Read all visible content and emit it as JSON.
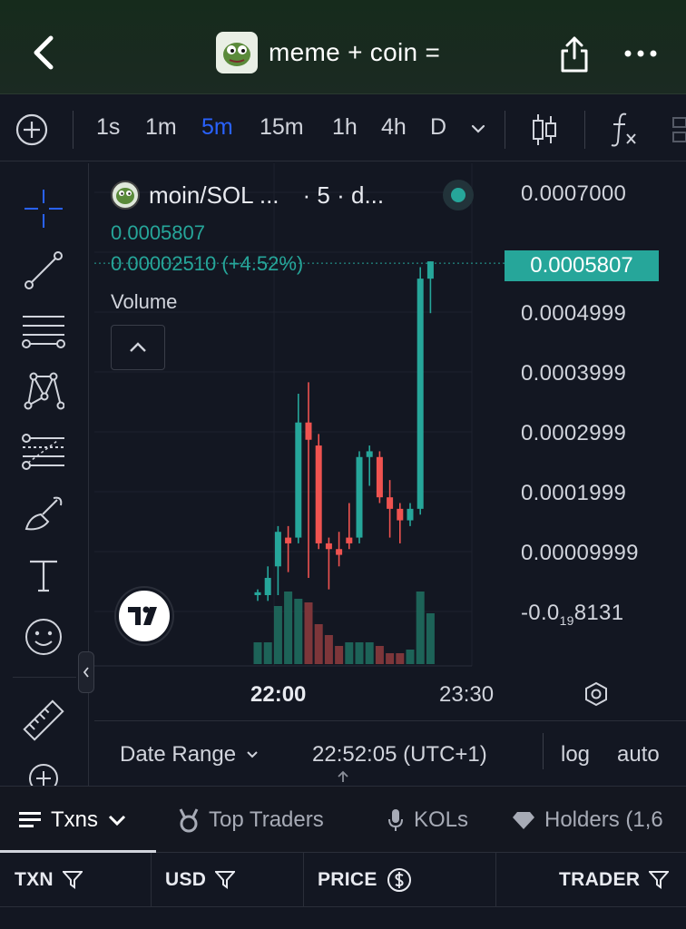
{
  "header": {
    "title": "meme + coin ="
  },
  "toolbar": {
    "intervals": [
      "1s",
      "1m",
      "5m",
      "15m",
      "1h",
      "4h",
      "D"
    ],
    "active_interval": "5m"
  },
  "chart": {
    "symbol": "moin/SOL ...",
    "interval": "· 5 · d...",
    "last_price": "0.0005807",
    "change": "0.00002510 (+4.52%)",
    "volume_label": "Volume",
    "price_tag": "0.0005807",
    "y_labels": [
      "0.0007000",
      "0.0004999",
      "0.0003999",
      "0.0002999",
      "0.0001999",
      "0.00009999"
    ],
    "y_negative": "-0.0",
    "y_negative_sub": "19",
    "y_negative_tail": "8131",
    "time_labels": [
      "22:00",
      "23:30"
    ],
    "date_range": "Date Range",
    "current_time": "22:52:05 (UTC+1)",
    "log": "log",
    "auto": "auto",
    "colors": {
      "up": "#26a69a",
      "down": "#ef5350",
      "accent": "#2962ff"
    }
  },
  "chart_data": {
    "type": "bar",
    "title": "",
    "xlabel": "",
    "ylabel": "",
    "ylim": [
      -2e-05,
      0.0007
    ],
    "time_ticks": [
      "22:00",
      "23:30"
    ],
    "candles": [
      {
        "o": 0.0,
        "h": 1e-05,
        "l": -1e-05,
        "c": 5e-06
      },
      {
        "o": 0.0,
        "h": 5e-05,
        "l": -1e-05,
        "c": 3e-05
      },
      {
        "o": 5e-05,
        "h": 0.00012,
        "l": 0.0,
        "c": 0.00011
      },
      {
        "o": 0.0001,
        "h": 0.00012,
        "l": 4e-05,
        "c": 9e-05
      },
      {
        "o": 0.0001,
        "h": 0.00035,
        "l": 9e-05,
        "c": 0.0003
      },
      {
        "o": 0.0003,
        "h": 0.00037,
        "l": 3e-05,
        "c": 0.00027
      },
      {
        "o": 0.00026,
        "h": 0.00028,
        "l": 8e-05,
        "c": 9e-05
      },
      {
        "o": 9e-05,
        "h": 0.0001,
        "l": 1e-05,
        "c": 8e-05
      },
      {
        "o": 8e-05,
        "h": 0.00011,
        "l": 5e-05,
        "c": 7e-05
      },
      {
        "o": 0.0001,
        "h": 0.00016,
        "l": 8e-05,
        "c": 9e-05
      },
      {
        "o": 0.0001,
        "h": 0.00025,
        "l": 9e-05,
        "c": 0.00024
      },
      {
        "o": 0.00024,
        "h": 0.00026,
        "l": 0.00019,
        "c": 0.00025
      },
      {
        "o": 0.00024,
        "h": 0.00025,
        "l": 0.00016,
        "c": 0.00017
      },
      {
        "o": 0.00017,
        "h": 0.0002,
        "l": 0.0001,
        "c": 0.00015
      },
      {
        "o": 0.00015,
        "h": 0.00016,
        "l": 9e-05,
        "c": 0.00013
      },
      {
        "o": 0.00013,
        "h": 0.00016,
        "l": 0.00012,
        "c": 0.00015
      },
      {
        "o": 0.00015,
        "h": 0.00057,
        "l": 0.00014,
        "c": 0.00055
      },
      {
        "o": 0.00055,
        "h": 0.00058,
        "l": 0.00049,
        "c": 0.00058
      }
    ],
    "volumes": [
      0.3,
      0.3,
      0.8,
      1.0,
      0.9,
      0.85,
      0.55,
      0.4,
      0.25,
      0.3,
      0.3,
      0.3,
      0.25,
      0.15,
      0.15,
      0.2,
      1.0,
      0.7
    ],
    "volume_up": [
      true,
      true,
      true,
      true,
      true,
      false,
      false,
      false,
      false,
      true,
      true,
      true,
      false,
      false,
      false,
      true,
      true,
      true
    ]
  },
  "tabs": [
    {
      "label": "Txns"
    },
    {
      "label": "Top Traders"
    },
    {
      "label": "KOLs"
    },
    {
      "label": "Holders (1,6"
    }
  ],
  "table": {
    "columns": [
      "TXN",
      "USD",
      "PRICE",
      "TRADER"
    ]
  }
}
